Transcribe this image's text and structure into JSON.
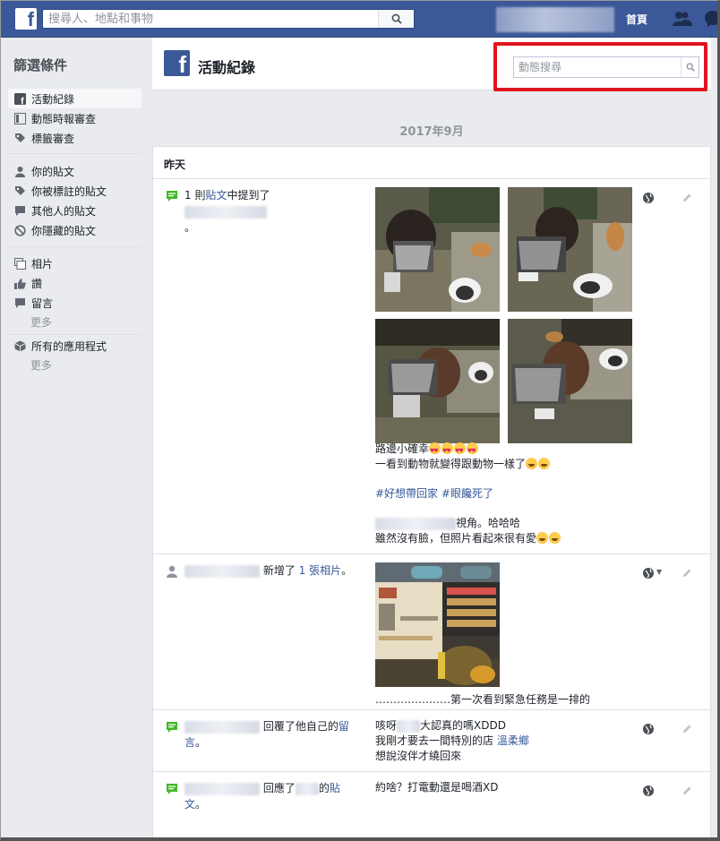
{
  "topbar": {
    "search_placeholder": "搜尋人、地點和事物",
    "home_label": "首頁"
  },
  "sidebar": {
    "title": "篩選條件",
    "items": [
      {
        "label": "活動紀錄",
        "icon": "fb-icon",
        "active": true
      },
      {
        "label": "動態時報審查",
        "icon": "timeline-review-icon"
      },
      {
        "label": "標籤審查",
        "icon": "tag-icon"
      },
      {
        "label": "你的貼文",
        "icon": "person-icon"
      },
      {
        "label": "你被標註的貼文",
        "icon": "tag-icon"
      },
      {
        "label": "其他人的貼文",
        "icon": "comment-icon"
      },
      {
        "label": "你隱藏的貼文",
        "icon": "hidden-icon"
      },
      {
        "label": "相片",
        "icon": "photos-icon"
      },
      {
        "label": "讚",
        "icon": "like-icon"
      },
      {
        "label": "留言",
        "icon": "comment-icon"
      },
      {
        "label": "所有的應用程式",
        "icon": "apps-icon"
      }
    ],
    "more_label": "更多"
  },
  "header": {
    "title": "活動紀錄",
    "search_placeholder": "動態搜尋"
  },
  "month_label": "2017年9月",
  "day_label": "昨天",
  "entries": [
    {
      "summary_prefix": "1 則",
      "summary_link": "貼文",
      "summary_mid": "中提到了",
      "summary_end": "。",
      "caption_line1": "路邊小確幸",
      "caption_line2": "一看到動物就變得跟動物一樣了",
      "hashtag1": "#好想帶回家",
      "hashtag2": "#眼饞死了",
      "mention_suffix": "視角。哈哈哈",
      "caption_line4": "雖然沒有臉，但照片看起來很有愛"
    },
    {
      "summary_mid": "新增了",
      "summary_link": "1 張相片",
      "summary_end": "。",
      "caption": "…………………第一次看到緊急任務是一排的"
    },
    {
      "summary_mid": "回覆了他自己的",
      "summary_link1": "留",
      "summary_link2": "言",
      "summary_end": "。",
      "line1_prefix": "咳呀",
      "line1_suffix": "大認真的嗎XDDD",
      "line2": "我剛才要去一間特別的店",
      "line2_link": "溫柔鄉",
      "line3": "想說沒伴才繞回來"
    },
    {
      "summary_mid": "回應了",
      "summary_mid2": "的",
      "summary_link1": "貼",
      "summary_link2": "文",
      "summary_end": "。",
      "line1": "約啥？打電動還是喝酒XD"
    }
  ],
  "colors": {
    "brand_blue": "#3b5998",
    "link": "#365899",
    "highlight_red": "#e0141e",
    "page_bg": "#e9ebee"
  }
}
